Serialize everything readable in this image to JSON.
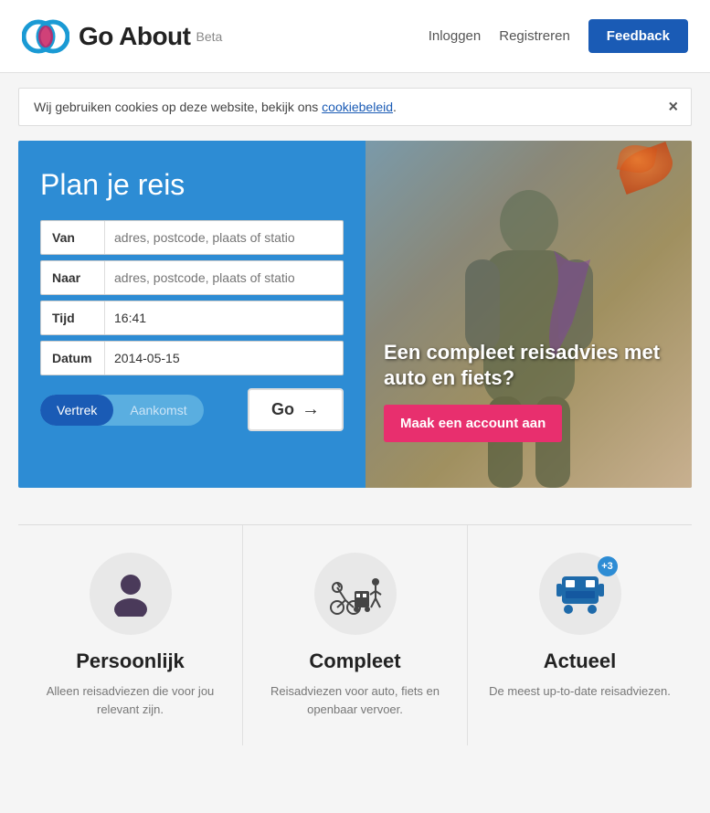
{
  "header": {
    "logo_text": "Go About",
    "logo_beta": "Beta",
    "nav": {
      "login": "Inloggen",
      "register": "Registreren",
      "feedback": "Feedback"
    }
  },
  "cookie_banner": {
    "text": "Wij gebruiken cookies op deze website, bekijk ons ",
    "link_text": "cookiebeleid",
    "close": "×"
  },
  "plan_form": {
    "title": "Plan je reis",
    "van_label": "Van",
    "van_placeholder": "adres, postcode, plaats of statio",
    "naar_label": "Naar",
    "naar_placeholder": "adres, postcode, plaats of statio",
    "tijd_label": "Tijd",
    "tijd_value": "16:41",
    "datum_label": "Datum",
    "datum_value": "2014-05-15",
    "vertrek": "Vertrek",
    "aankomst": "Aankomst",
    "go_button": "Go"
  },
  "promo": {
    "text": "Een compleet reisadvies met auto en fiets?",
    "button": "Maak een account aan"
  },
  "features": [
    {
      "id": "persoonlijk",
      "title": "Persoonlijk",
      "description": "Alleen reisadviezen die voor jou relevant zijn.",
      "icon": "person",
      "badge": null
    },
    {
      "id": "compleet",
      "title": "Compleet",
      "description": "Reisadviezen voor auto, fiets en openbaar vervoer.",
      "icon": "transport",
      "badge": null
    },
    {
      "id": "actueel",
      "title": "Actueel",
      "description": "De meest up-to-date reisadviezen.",
      "icon": "bus",
      "badge": "+3"
    }
  ]
}
